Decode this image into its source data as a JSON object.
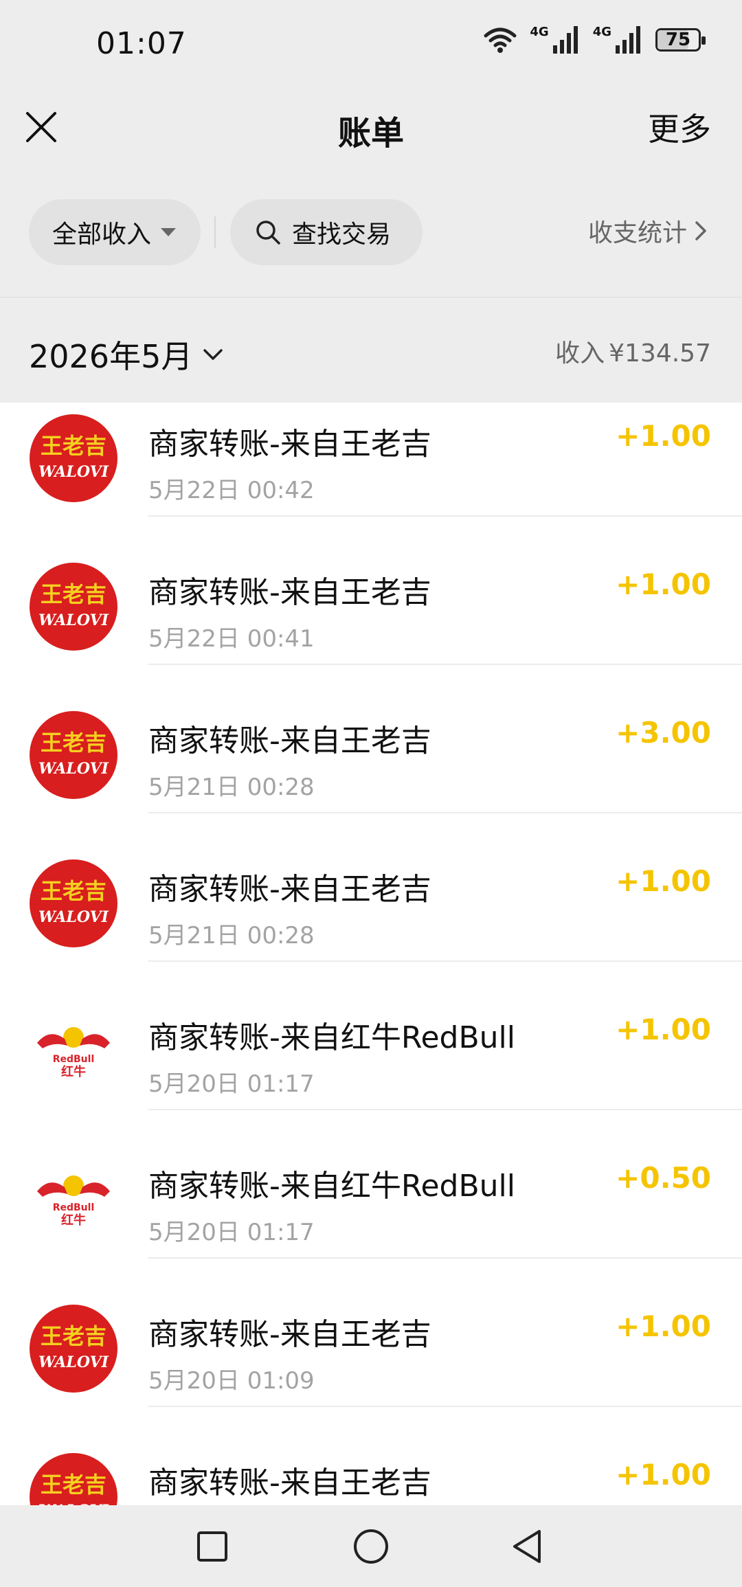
{
  "status": {
    "time": "01:07",
    "signal_tag": "4G",
    "battery": "75"
  },
  "header": {
    "title": "账单",
    "more": "更多",
    "close_icon": "close-icon"
  },
  "filters": {
    "type_label": "全部收入",
    "search_label": "查找交易",
    "stats_label": "收支统计"
  },
  "month": {
    "label": "2026年5月",
    "income_label": "收入",
    "income_value": "¥134.57"
  },
  "colors": {
    "amount": "#f5c400",
    "background": "#ededed",
    "wanglaoji_red": "#d81e1e",
    "wanglaoji_gold": "#f5d020",
    "redbull_red": "#d8232a",
    "redbull_yellow": "#f4c400"
  },
  "transactions": [
    {
      "title": "商家转账-来自王老吉",
      "date": "5月22日 00:42",
      "amount": "+1.00",
      "merchant": "wanglaoji"
    },
    {
      "title": "商家转账-来自王老吉",
      "date": "5月22日 00:41",
      "amount": "+1.00",
      "merchant": "wanglaoji"
    },
    {
      "title": "商家转账-来自王老吉",
      "date": "5月21日 00:28",
      "amount": "+3.00",
      "merchant": "wanglaoji"
    },
    {
      "title": "商家转账-来自王老吉",
      "date": "5月21日 00:28",
      "amount": "+1.00",
      "merchant": "wanglaoji"
    },
    {
      "title": "商家转账-来自红牛RedBull",
      "date": "5月20日 01:17",
      "amount": "+1.00",
      "merchant": "redbull"
    },
    {
      "title": "商家转账-来自红牛RedBull",
      "date": "5月20日 01:17",
      "amount": "+0.50",
      "merchant": "redbull"
    },
    {
      "title": "商家转账-来自王老吉",
      "date": "5月20日 01:09",
      "amount": "+1.00",
      "merchant": "wanglaoji"
    },
    {
      "title": "商家转账-来自王老吉",
      "date": "",
      "amount": "+1.00",
      "merchant": "wanglaoji"
    }
  ],
  "logos": {
    "wanglaoji": {
      "cn": "王老吉",
      "en": "WALOVI"
    },
    "redbull": {
      "en": "RedBull",
      "cn": "红牛"
    }
  },
  "nav": {
    "recent_icon": "square-icon",
    "home_icon": "circle-icon",
    "back_icon": "triangle-back-icon"
  }
}
